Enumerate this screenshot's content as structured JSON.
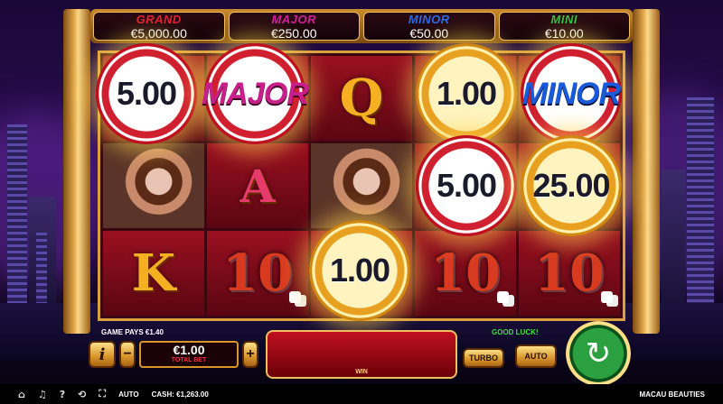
{
  "jackpots": [
    {
      "name": "GRAND",
      "value": "€5,000.00",
      "color": "#e02030"
    },
    {
      "name": "MAJOR",
      "value": "€250.00",
      "color": "#d0209a"
    },
    {
      "name": "MINOR",
      "value": "€50.00",
      "color": "#2a6ae8"
    },
    {
      "name": "MINI",
      "value": "€10.00",
      "color": "#30c040"
    }
  ],
  "reels": {
    "symbols": [
      "Q",
      "A",
      "K",
      "10",
      "10",
      "10",
      "10"
    ]
  },
  "coins": [
    {
      "value": "5.00",
      "style": "red"
    },
    {
      "label": "MAJOR",
      "style": "red"
    },
    {
      "value": "1.00",
      "style": "gold"
    },
    {
      "label": "MINOR",
      "style": "red"
    },
    {
      "value": "5.00",
      "style": "red"
    },
    {
      "value": "25.00",
      "style": "gold"
    },
    {
      "value": "1.00",
      "style": "gold"
    }
  ],
  "messages": {
    "game_pays": "GAME PAYS €1.40",
    "good_luck": "GOOD LUCK!"
  },
  "controls": {
    "info": "i",
    "minus": "−",
    "plus": "+",
    "bet_value": "€1.00",
    "bet_label": "TOTAL BET",
    "win_label": "WIN",
    "turbo": "TURBO",
    "auto": "AUTO",
    "spin_icon": "↻"
  },
  "status": {
    "home_icon": "⌂",
    "sound_icon": "♫",
    "help_icon": "?",
    "history_icon": "⟲",
    "fullscreen_icon": "⛶",
    "auto": "AUTO",
    "cash_label": "CASH:",
    "cash_value": "€1,263.00",
    "game_title": "MACAU BEAUTIES"
  }
}
